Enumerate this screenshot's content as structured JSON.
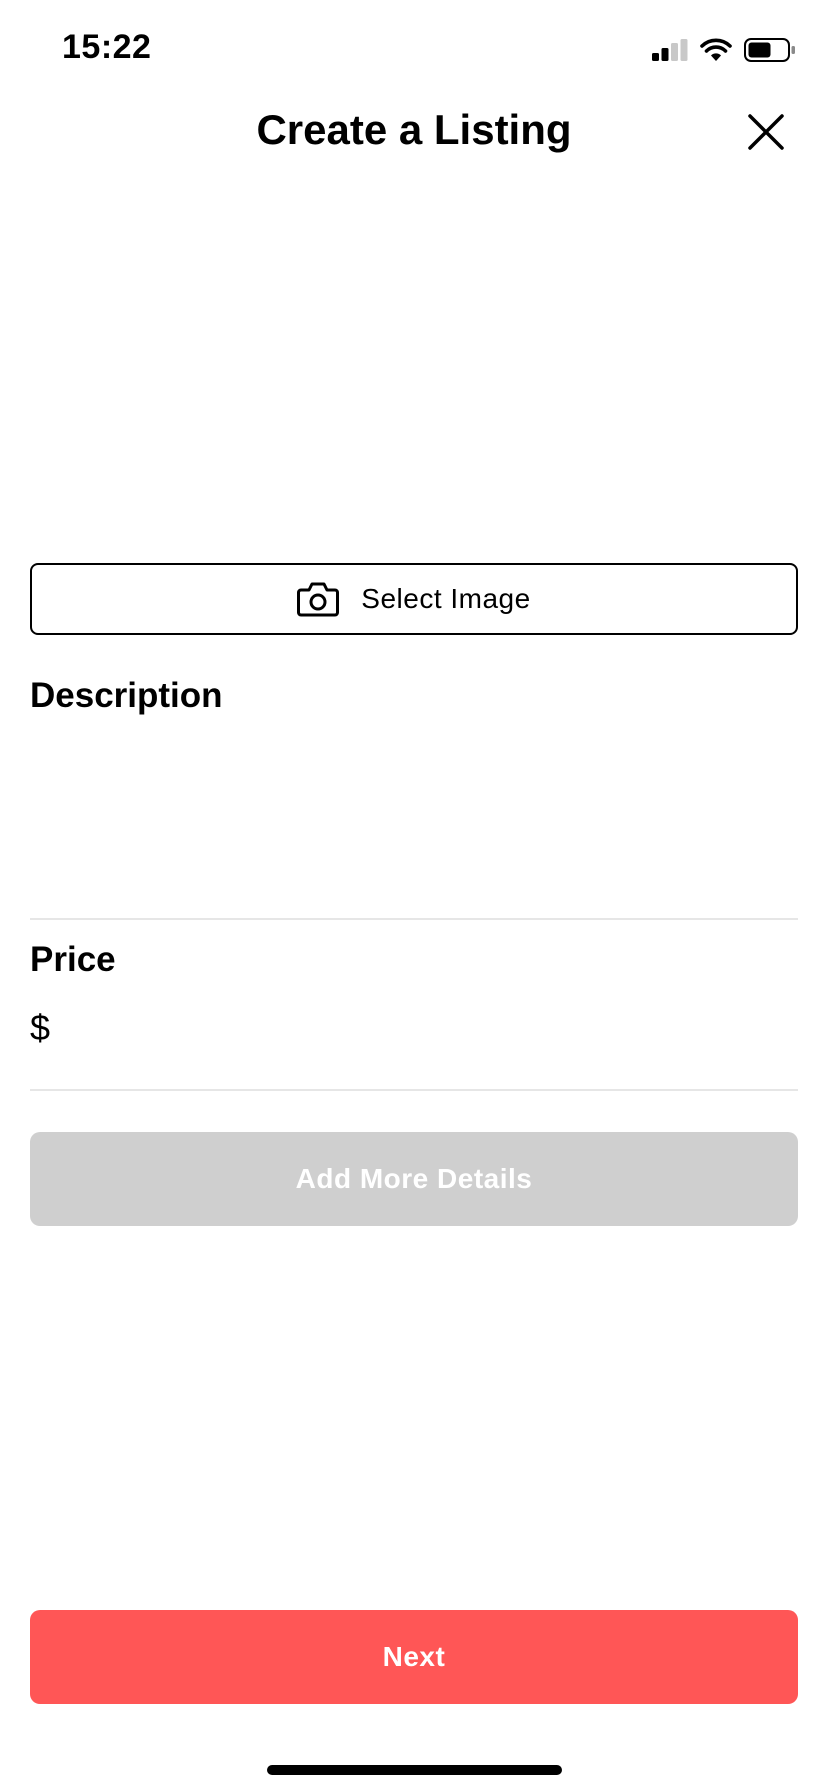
{
  "status_bar": {
    "time": "15:22",
    "icons": [
      "cellular-signal-icon",
      "wifi-icon",
      "battery-icon"
    ]
  },
  "header": {
    "title": "Create a Listing",
    "close_icon": "close-icon"
  },
  "image_picker": {
    "button_label": "Select Image",
    "icon": "camera-icon"
  },
  "description": {
    "label": "Description",
    "value": ""
  },
  "price": {
    "label": "Price",
    "currency": "$",
    "value": ""
  },
  "add_details": {
    "label": "Add More Details",
    "enabled": false
  },
  "next": {
    "label": "Next"
  },
  "colors": {
    "accent": "#ff5656",
    "disabled": "#cfcfcf",
    "divider": "#e6e6e6",
    "text": "#000000"
  }
}
